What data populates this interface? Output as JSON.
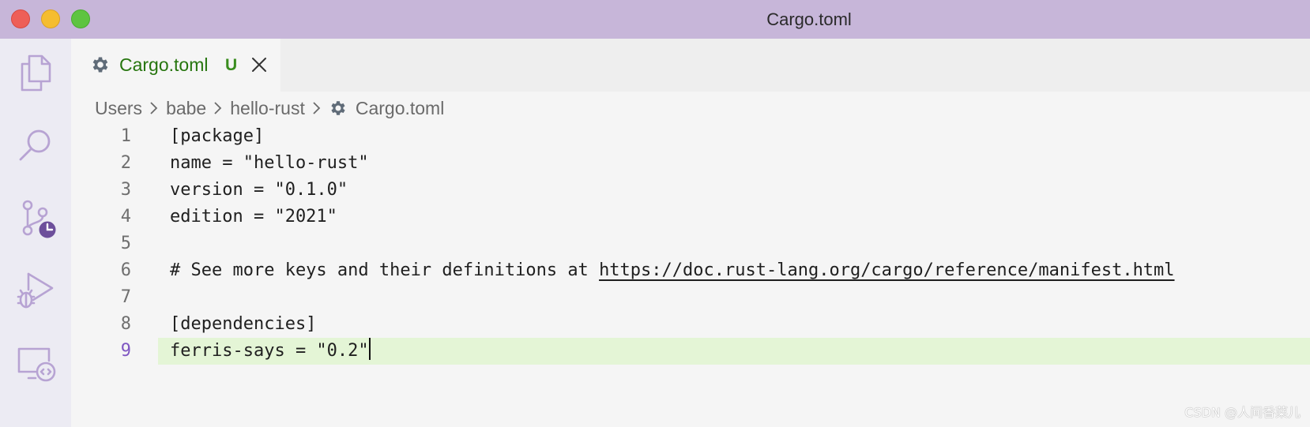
{
  "window": {
    "title": "Cargo.toml",
    "controls": [
      "close",
      "minimize",
      "maximize"
    ]
  },
  "activity_bar": {
    "items": [
      {
        "icon": "files-icon"
      },
      {
        "icon": "search-icon"
      },
      {
        "icon": "source-control-icon",
        "badge_icon": "clock-icon"
      },
      {
        "icon": "run-debug-icon"
      },
      {
        "icon": "remote-explorer-icon"
      }
    ]
  },
  "tab": {
    "label": "Cargo.toml",
    "status": "U",
    "icon": "gear-icon",
    "close_icon": "close-icon"
  },
  "breadcrumb": {
    "items": [
      "Users",
      "babe",
      "hello-rust",
      "Cargo.toml"
    ],
    "file_icon": "gear-icon"
  },
  "code": {
    "current_line": 9,
    "lines": [
      {
        "num": "1",
        "text": "[package]"
      },
      {
        "num": "2",
        "text": "name = \"hello-rust\""
      },
      {
        "num": "3",
        "text": "version = \"0.1.0\""
      },
      {
        "num": "4",
        "text": "edition = \"2021\""
      },
      {
        "num": "5",
        "text": ""
      },
      {
        "num": "6",
        "text": "# See more keys and their definitions at ",
        "link": "https://doc.rust-lang.org/cargo/reference/manifest.html"
      },
      {
        "num": "7",
        "text": ""
      },
      {
        "num": "8",
        "text": "[dependencies]"
      },
      {
        "num": "9",
        "text": "ferris-says = \"0.2\""
      }
    ]
  },
  "watermark": "CSDN @人间香菜儿",
  "colors": {
    "titlebar": "#c7b6d9",
    "activitybar": "#ecebf3",
    "tab_label": "#26750e",
    "current_line_bg": "#e4f5d6",
    "current_line_number": "#7f57c2",
    "icon": "#b7a3d3"
  }
}
